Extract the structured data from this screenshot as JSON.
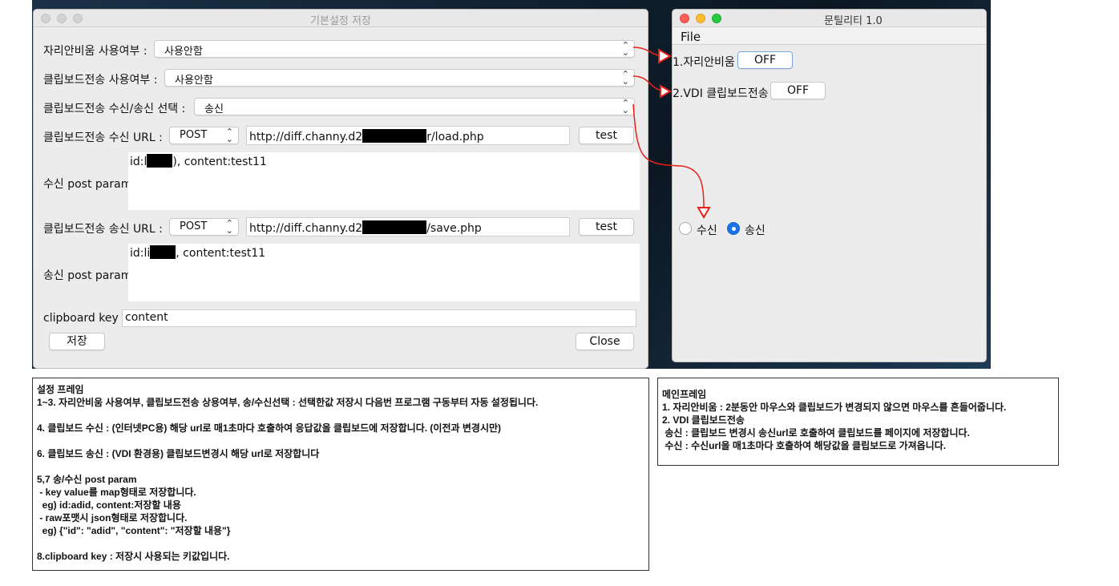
{
  "settings_window": {
    "title": "기본설정 저장",
    "idle_mouse_label": "자리안비움 사용여부 :",
    "idle_mouse_value": "사용안함",
    "clipboard_send_label": "클립보드전송 사용여부 :",
    "clipboard_send_value": "사용안함",
    "direction_label": "클립보드전송 수신/송신 선택 :",
    "direction_value": "송신",
    "recv_url_label": "클립보드전송 수신 URL :",
    "recv_method": "POST",
    "recv_url_prefix": "http://diff.channy.d2",
    "recv_url_suffix": "r/load.php",
    "recv_test": "test",
    "recv_param_label": "수신 post param",
    "recv_param_prefix": "id:l",
    "recv_param_suffix": "), content:test11",
    "send_url_label": "클립보드전송 송신 URL :",
    "send_method": "POST",
    "send_url_prefix": "http://diff.channy.d2",
    "send_url_suffix": "/save.php",
    "send_test": "test",
    "send_param_label": "송신 post param",
    "send_param_prefix": "id:li",
    "send_param_suffix": ", content:test11",
    "clipboard_key_label": "clipboard key",
    "clipboard_key_value": "content",
    "save_button": "저장",
    "close_button": "Close"
  },
  "main_window": {
    "title": "문틸리티 1.0",
    "menu_file": "File",
    "idle_label": "1.자리안비움",
    "idle_toggle": "OFF",
    "vdi_label": "2.VDI 클립보드전송",
    "vdi_toggle": "OFF",
    "radio_recv": "수신",
    "radio_send": "송신",
    "selected_radio": "송신"
  },
  "note_left": {
    "lines": [
      "설정 프레임",
      "1~3. 자리안비움 사용여부, 클립보드전송 상용여부, 송/수신선택 : 선택한값 저장시 다음번 프로그램 구동부터 자동 설정됩니다.",
      "",
      "4. 클립보드 수신 : (인터넷PC용) 해당 url로 매1초마다 호출하여 응답값을 클립보드에 저장합니다. (이전과 변경시만)",
      "",
      "6. 클립보드 송신 : (VDI 환경용) 클립보드변경시 해당 url로 저장합니다",
      "",
      "5,7 송/수신 post param",
      " - key value를 map형태로 저장합니다.",
      "  eg) id:adid, content:저장할 내용",
      " - raw포맷시 json형태로 저장합니다.",
      "  eg) {\"id\": \"adid\", \"content\": \"저장할 내용\"}",
      "",
      "8.clipboard key : 저장시 사용되는 키값입니다."
    ]
  },
  "note_right": {
    "lines": [
      "",
      "메인프레임",
      "1. 자리안비움 : 2분동안 마우스와 클립보드가 변경되지 않으면 마우스를 흔들어줍니다.",
      "2. VDI 클립보드전송",
      " 송신 : 클립보드 변경시 송신url로 호출하여 클립보드를 페이지에 저장합니다.",
      " 수신 : 수신url을 매1초마다 호출하여 해당값을 클립보드로 가져옵니다."
    ]
  },
  "colors": {
    "arrow": "#e8201a",
    "radio_selected": "#1a73e8"
  }
}
